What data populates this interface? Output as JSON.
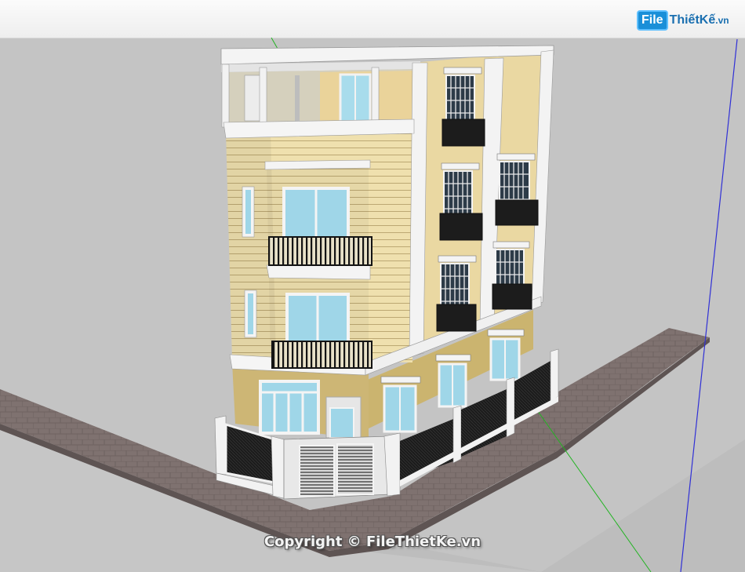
{
  "watermark": {
    "logo_badge": "File",
    "logo_rest": "ThiếtKế",
    "logo_suffix": ".vn"
  },
  "copyright": "Copyright © FileThietKe.vn",
  "colors": {
    "background": "#c4c4c4",
    "toolbar": "#f2f2f2",
    "sidewalk": "#7d6f6c",
    "wall_cream": "#efe1b0",
    "wall_tan": "#cdb774",
    "frame_white": "#f4f4f4",
    "glass": "#9fd6e8",
    "railing": "#1e1e1e",
    "axis_blue": "#2a2ad8",
    "axis_green": "#1fb41f"
  }
}
